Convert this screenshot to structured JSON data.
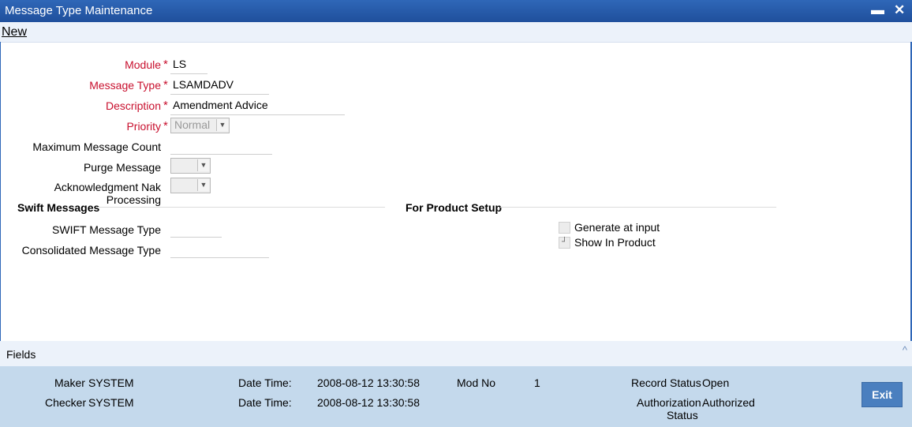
{
  "window": {
    "title": "Message Type Maintenance",
    "minimize_glyph": "▬",
    "close_glyph": "✕"
  },
  "menu": {
    "new_label": "New"
  },
  "form": {
    "module": {
      "label": "Module",
      "value": "LS"
    },
    "message_type": {
      "label": "Message Type",
      "value": "LSAMDADV"
    },
    "description": {
      "label": "Description",
      "value": "Amendment Advice"
    },
    "priority": {
      "label": "Priority",
      "value": "Normal"
    },
    "max_message_count": {
      "label": "Maximum Message Count",
      "value": ""
    },
    "purge_message": {
      "label": "Purge Message",
      "value": ""
    },
    "ack_nak": {
      "label": "Acknowledgment Nak Processing",
      "value": ""
    },
    "required_marker": "*"
  },
  "swift": {
    "heading": "Swift Messages",
    "swift_message_type": {
      "label": "SWIFT Message Type",
      "value": ""
    },
    "consolidated_message_type": {
      "label": "Consolidated Message Type",
      "value": ""
    }
  },
  "product_setup": {
    "heading": "For Product Setup",
    "generate_at_input": {
      "label": "Generate at input",
      "checked": false
    },
    "show_in_product": {
      "label": "Show In Product",
      "checked": false
    }
  },
  "fields_bar": {
    "label": "Fields"
  },
  "audit": {
    "maker_label": "Maker",
    "maker_value": "SYSTEM",
    "checker_label": "Checker",
    "checker_value": "SYSTEM",
    "datetime_label": "Date Time:",
    "maker_datetime": "2008-08-12 13:30:58",
    "checker_datetime": "2008-08-12 13:30:58",
    "modno_label": "Mod No",
    "modno_value": "1",
    "record_status_label": "Record Status",
    "record_status_value": "Open",
    "auth_status_label_1": "Authorization",
    "auth_status_label_2": "Status",
    "auth_status_value": "Authorized"
  },
  "buttons": {
    "exit_label": "Exit"
  },
  "colors": {
    "title_bar": "#2f67b8",
    "required": "#c8102e",
    "footer": "#c4d9ec",
    "exit_button": "#4a7fbf"
  }
}
